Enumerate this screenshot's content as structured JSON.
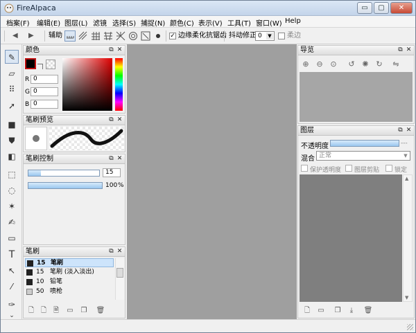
{
  "window": {
    "title": "FireAlpaca",
    "minimize": "▭",
    "maximize": "▢",
    "close": "✕"
  },
  "menu": [
    "档案(F)",
    "编辑(E)",
    "图层(L)",
    "滤镜",
    "选择(S)",
    "捕捉(N)",
    "颜色(C)",
    "表示(V)",
    "工具(T)",
    "窗口(W)",
    "Help"
  ],
  "toolbar": {
    "prev": "◀",
    "next": "▶",
    "assist_label": "辅助",
    "antialias_label": "边缘柔化抗锯齿",
    "antialias_checked": true,
    "stabilizer_label": "抖动修正",
    "stabilizer_value": "0",
    "soft_label": "柔边",
    "soft_checked": false
  },
  "tools": [
    "pen-tool",
    "eraser-tool",
    "dot-tool",
    "move-tool",
    "fill-rect-tool",
    "bucket-tool",
    "gradient-tool",
    "select-rect-tool",
    "lasso-tool",
    "magic-wand-tool",
    "select-pen-tool",
    "select-eraser-tool",
    "text-tool",
    "operation-tool",
    "eyedropper-tool",
    "hand-pen-tool"
  ],
  "color_panel": {
    "title": "颜色",
    "labels": {
      "r": "R",
      "g": "G",
      "b": "B"
    },
    "values": {
      "r": "0",
      "g": "0",
      "b": "0"
    },
    "primary": "#000000"
  },
  "brush_preview": {
    "title": "笔刷预览"
  },
  "brush_control": {
    "title": "笔刷控制",
    "size": "15",
    "opacity": "100",
    "opacity_unit": "%",
    "size_fill": 0.18,
    "opacity_fill": 1.0
  },
  "brush_panel": {
    "title": "笔刷",
    "items": [
      {
        "size": "15",
        "name": "笔刷"
      },
      {
        "size": "15",
        "name": "笔刷 (淡入淡出)"
      },
      {
        "size": "10",
        "name": "铅笔"
      },
      {
        "size": "50",
        "name": "喷枪"
      }
    ]
  },
  "navigator": {
    "title": "导览"
  },
  "layers": {
    "title": "图层",
    "opacity_label": "不透明度",
    "opacity_value": "---",
    "blend_label": "混合",
    "blend_value": "正常",
    "protect_alpha": "保护透明度",
    "clipping": "图层剪贴",
    "lock": "锁定"
  },
  "panel_buttons": {
    "dock": "⧉",
    "close": "✕"
  }
}
